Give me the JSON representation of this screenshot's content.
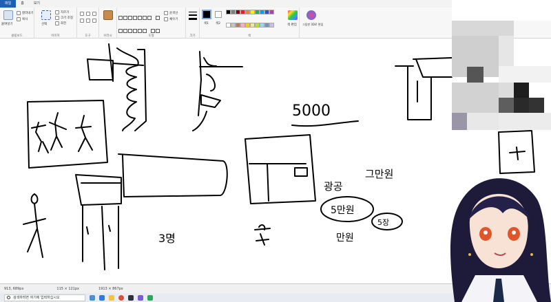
{
  "tabs": [
    "파일",
    "홈",
    "보기"
  ],
  "ribbon": {
    "clipboard": {
      "paste": "붙여넣기",
      "cut": "잘라내기",
      "copy": "복사",
      "label": "클립보드"
    },
    "image": {
      "select": "선택",
      "crop": "자르기",
      "resize": "크기 조정",
      "rotate": "회전",
      "label": "이미지"
    },
    "tools": {
      "label": "도구"
    },
    "brushes": {
      "label": "브러시"
    },
    "shapes": {
      "outline": "윤곽선",
      "fill": "채우기",
      "label": "도형"
    },
    "size": {
      "label": "크기"
    },
    "colors": {
      "color1": "색1",
      "color2": "색2",
      "edit": "색 편집",
      "label": "색"
    },
    "paint3d": {
      "label": "그림판 3D로 편집"
    },
    "palette": [
      "#000000",
      "#7f7f7f",
      "#880015",
      "#ed1c24",
      "#ff7f27",
      "#fff200",
      "#22b14c",
      "#00a2e8",
      "#3f48cc",
      "#a349a4",
      "#ffffff",
      "#c3c3c3",
      "#b97a57",
      "#ffaec9",
      "#ffc90e",
      "#efe4b0",
      "#b5e61d",
      "#99d9ea",
      "#7092be",
      "#c8bfe7"
    ]
  },
  "canvas_text": {
    "number": "5000",
    "hangul1": "광공",
    "hangul2": "그만원",
    "hangul3": "5만원",
    "hangul4": "만원",
    "hangul5": "5장",
    "hangul6": "3명"
  },
  "status": {
    "cursor": "913, 689px",
    "selection": "115 × 121px",
    "canvas": "1913 × 867px"
  },
  "taskbar": {
    "search_placeholder": "검색하려면 여기에 입력하십시오"
  },
  "colors": {
    "accent": "#1e5fb4",
    "avatar_hair": "#1d1a3a",
    "avatar_eye": "#e0552a"
  }
}
